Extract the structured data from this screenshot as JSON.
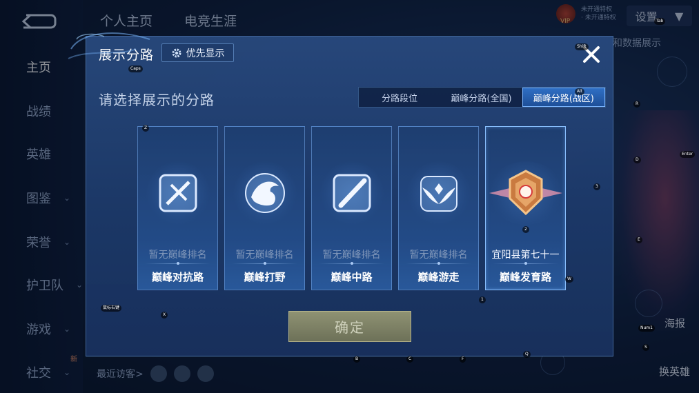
{
  "background": {
    "top_tabs": [
      "个人主页",
      "电竞生涯"
    ],
    "left_nav": [
      {
        "label": "主页",
        "chevron": false,
        "active": true
      },
      {
        "label": "战绩",
        "chevron": false,
        "active": false
      },
      {
        "label": "英雄",
        "chevron": false,
        "active": false
      },
      {
        "label": "图鉴",
        "chevron": true,
        "active": false
      },
      {
        "label": "荣誉",
        "chevron": true,
        "active": false
      },
      {
        "label": "护卫队",
        "chevron": true,
        "active": false
      },
      {
        "label": "游戏",
        "chevron": true,
        "active": false
      },
      {
        "label": "社交",
        "chevron": true,
        "active": false
      }
    ],
    "new_badge": "新",
    "settings_label": "设置",
    "vip_label": "VIP",
    "top_right_lines": [
      "未开通特权",
      "· 未开通特权"
    ],
    "data_button": "和数据展示",
    "recent_visitors": "最近访客>",
    "side_buttons": {
      "poster": "海报",
      "change_hero": "换英雄"
    }
  },
  "key_hints": [
    {
      "t": "Caps"
    },
    {
      "t": "Shift"
    },
    {
      "t": "Tab"
    },
    {
      "t": "Alt"
    },
    {
      "t": "R"
    },
    {
      "t": "D"
    },
    {
      "t": "Enter"
    },
    {
      "t": "3"
    },
    {
      "t": "Z"
    },
    {
      "t": "2"
    },
    {
      "t": "E"
    },
    {
      "t": "W"
    },
    {
      "t": "1"
    },
    {
      "t": "鼠标右键"
    },
    {
      "t": "X"
    },
    {
      "t": "Num1"
    },
    {
      "t": "S"
    },
    {
      "t": "B"
    },
    {
      "t": "C"
    },
    {
      "t": "F"
    },
    {
      "t": "Q"
    }
  ],
  "dialog": {
    "title": "展示分路",
    "priority_button": "优先显示",
    "subtitle": "请选择展示的分路",
    "segment_tabs": [
      {
        "label": "分路段位",
        "selected": false
      },
      {
        "label": "巅峰分路(全国)",
        "selected": false
      },
      {
        "label": "巅峰分路(战区)",
        "selected": true
      }
    ],
    "cards": [
      {
        "lane": "巅峰对抗路",
        "rank": "暂无巅峰排名",
        "icon": "sword-crest-icon",
        "has_rank": false
      },
      {
        "lane": "巅峰打野",
        "rank": "暂无巅峰排名",
        "icon": "dragon-crest-icon",
        "has_rank": false
      },
      {
        "lane": "巅峰中路",
        "rank": "暂无巅峰排名",
        "icon": "wand-crest-icon",
        "has_rank": false
      },
      {
        "lane": "巅峰游走",
        "rank": "暂无巅峰排名",
        "icon": "wings-crest-icon",
        "has_rank": false
      },
      {
        "lane": "巅峰发育路",
        "rank": "宜阳县第七十一",
        "icon": "bronze-rank-badge-icon",
        "has_rank": true
      }
    ],
    "confirm_button": "确定"
  },
  "colors": {
    "accent": "#2f6fc4",
    "confirm_disabled": "#7d8166",
    "rank_muted": "#7f96b9"
  }
}
